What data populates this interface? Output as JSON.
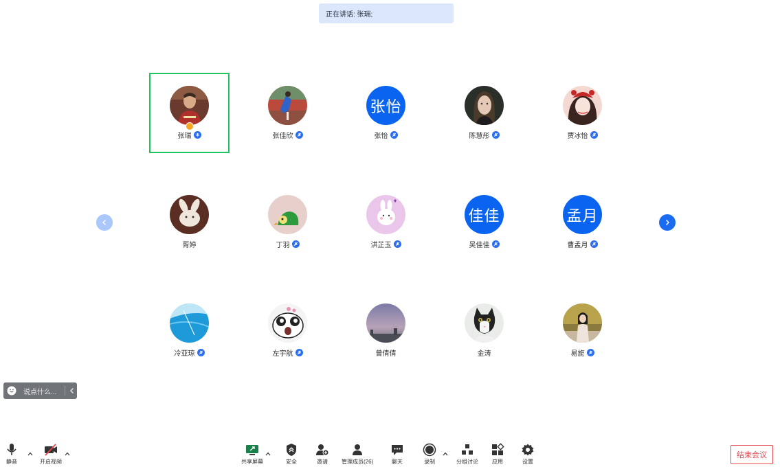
{
  "banner": {
    "speaking_text": "正在讲话: 张瑞;"
  },
  "participants": [
    {
      "name": "张瑞",
      "avatar": "photo-man-red-shirt",
      "mic": "talking"
    },
    {
      "name": "张佳欣",
      "avatar": "photo-field-runner",
      "mic": "muted"
    },
    {
      "name": "张怡",
      "avatar_text": "张怡",
      "mic": "muted"
    },
    {
      "name": "陈慧彤",
      "avatar": "photo-portrait-woman",
      "mic": "muted"
    },
    {
      "name": "贾冰怡",
      "avatar": "photo-holiday-girl",
      "mic": "muted"
    },
    {
      "name": "胥婷",
      "avatar": "photo-plush-bunny",
      "mic": "none"
    },
    {
      "name": "丁羽",
      "avatar": "photo-green-bird",
      "mic": "muted"
    },
    {
      "name": "洪芷玉",
      "avatar": "illustration-bunny",
      "mic": "muted"
    },
    {
      "name": "吴佳佳",
      "avatar_text": "佳佳",
      "mic": "muted"
    },
    {
      "name": "曹孟月",
      "avatar_text": "孟月",
      "mic": "muted"
    },
    {
      "name": "冷亚琼",
      "avatar": "photo-blue-sea",
      "mic": "muted"
    },
    {
      "name": "左宇航",
      "avatar": "illustration-panda-face",
      "mic": "muted"
    },
    {
      "name": "曾倩倩",
      "avatar": "photo-dusk-sky",
      "mic": "none"
    },
    {
      "name": "金涛",
      "avatar": "photo-cat",
      "mic": "none"
    },
    {
      "name": "易旎",
      "avatar": "photo-woman-street",
      "mic": "muted"
    }
  ],
  "chat": {
    "placeholder": "说点什么..."
  },
  "toolbar": {
    "mute": "静音",
    "video": "开启视频",
    "share": "共享屏幕",
    "security": "安全",
    "invite": "邀请",
    "members": "管理成员(26)",
    "chat": "聊天",
    "record": "录制",
    "breakout": "分组讨论",
    "apps": "应用",
    "settings": "设置",
    "end_meeting": "结束会议"
  },
  "colors": {
    "accent": "#0a64f0",
    "active_border": "#1fc55e",
    "end_button": "#e5484d",
    "host_badge": "#f5a623"
  }
}
